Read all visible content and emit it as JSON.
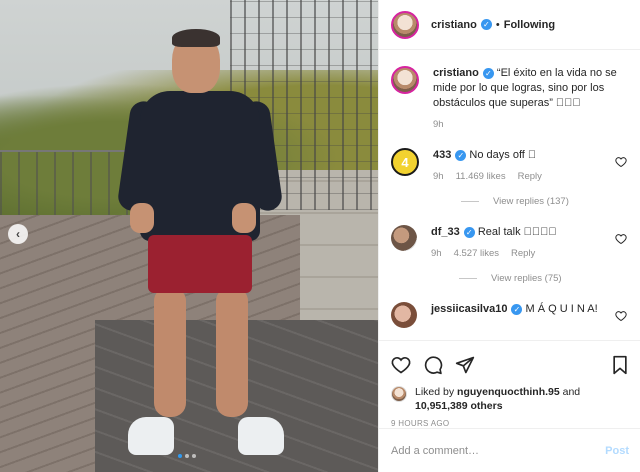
{
  "post": {
    "username": "cristiano",
    "verified_mark": "✓",
    "follow_status": "Following",
    "separator": "•"
  },
  "caption": {
    "username": "cristiano",
    "text": "“El éxito en la vida no se mide por lo que logras, sino por los obstáculos que superas” 🏼🏼🏼",
    "age": "9h"
  },
  "comments": [
    {
      "username": "433",
      "avatar_text": "4",
      "text": "No days off 🏼",
      "age": "9h",
      "likes": "11.469 likes",
      "reply": "Reply",
      "view_replies": "View replies (137)"
    },
    {
      "username": "df_33",
      "text": "Real talk 🏼🏼🏼🏼",
      "age": "9h",
      "likes": "4.527 likes",
      "reply": "Reply",
      "view_replies": "View replies (75)"
    },
    {
      "username": "jessiicasilva10",
      "text": "M Á Q U I N A!"
    }
  ],
  "likes": {
    "prefix": "Liked by",
    "user": "nguyenquocthinh.95",
    "and": "and",
    "others": "10,951,389 others"
  },
  "timestamp": "9 HOURS AGO",
  "add_comment": {
    "placeholder": "Add a comment…",
    "post_label": "Post"
  },
  "colors": {
    "verified": "#3897f0",
    "shorts": "#9b2130",
    "post_disabled": "#b3dbff",
    "carousel_active": "#2f9bf3"
  },
  "icons": [
    "heart-icon",
    "comment-icon",
    "share-icon",
    "bookmark-icon",
    "chevron-left-icon"
  ]
}
